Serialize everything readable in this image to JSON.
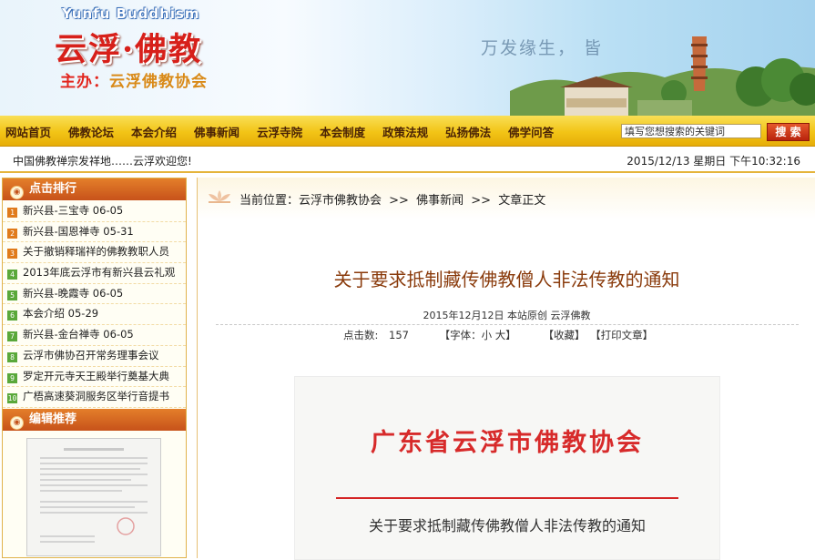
{
  "banner": {
    "brand_en": "Yunfu Buddhism",
    "brand_cn": "云浮·佛教",
    "host_prefix": "主办：",
    "host_org": "云浮佛教协会",
    "slogan": "万发缘生， 皆"
  },
  "nav": {
    "items": [
      "网站首页",
      "佛教论坛",
      "本会介绍",
      "佛事新闻",
      "云浮寺院",
      "本会制度",
      "政策法规",
      "弘扬佛法",
      "佛学问答"
    ],
    "search_placeholder": "填写您想搜索的关键词",
    "search_button": "搜 索"
  },
  "statusbar": {
    "welcome": "中国佛教禅宗发祥地……云浮欢迎您!",
    "datetime": "2015/12/13 星期日 下午10:32:16"
  },
  "sidebar": {
    "rank_title": "点击排行",
    "rank_items": [
      {
        "num": "1",
        "text": "新兴县-三宝寺 06-05"
      },
      {
        "num": "2",
        "text": "新兴县-国恩禅寺 05-31"
      },
      {
        "num": "3",
        "text": "关于撤销释瑞祥的佛教教职人员"
      },
      {
        "num": "4",
        "text": "2013年底云浮市有新兴县云礼观"
      },
      {
        "num": "5",
        "text": "新兴县-晚霞寺 06-05"
      },
      {
        "num": "6",
        "text": "本会介绍 05-29"
      },
      {
        "num": "7",
        "text": "新兴县-金台禅寺 06-05"
      },
      {
        "num": "8",
        "text": "云浮市佛协召开常务理事会议"
      },
      {
        "num": "9",
        "text": "罗定开元寺天王殿举行奠基大典"
      },
      {
        "num": "10",
        "text": "广梧高速葵洞服务区举行音提书"
      }
    ],
    "editor_title": "编辑推荐"
  },
  "content": {
    "breadcrumb": [
      "当前位置：云浮市佛教协会",
      ">>",
      "佛事新闻",
      ">>",
      "文章正文"
    ],
    "title": "关于要求抵制藏传佛教僧人非法传教的通知",
    "meta": "2015年12月12日 本站原创 云浮佛教",
    "clicks_label": "点击数:",
    "clicks_value": "157",
    "font_label": "【字体：小 大】",
    "favorite": "【收藏】",
    "print": "【打印文章】",
    "doc_header": "广东省云浮市佛教协会",
    "doc_subtitle": "关于要求抵制藏传佛教僧人非法传教的通知"
  },
  "colors": {
    "nav_bg": "#f2c416",
    "panel_head": "#d0621e",
    "title_brown": "#8a3b0c",
    "doc_red": "#d72a2a"
  },
  "icons": [
    "lotus-icon",
    "rank-dot-icon",
    "editor-dot-icon",
    "number-badge-icon"
  ]
}
